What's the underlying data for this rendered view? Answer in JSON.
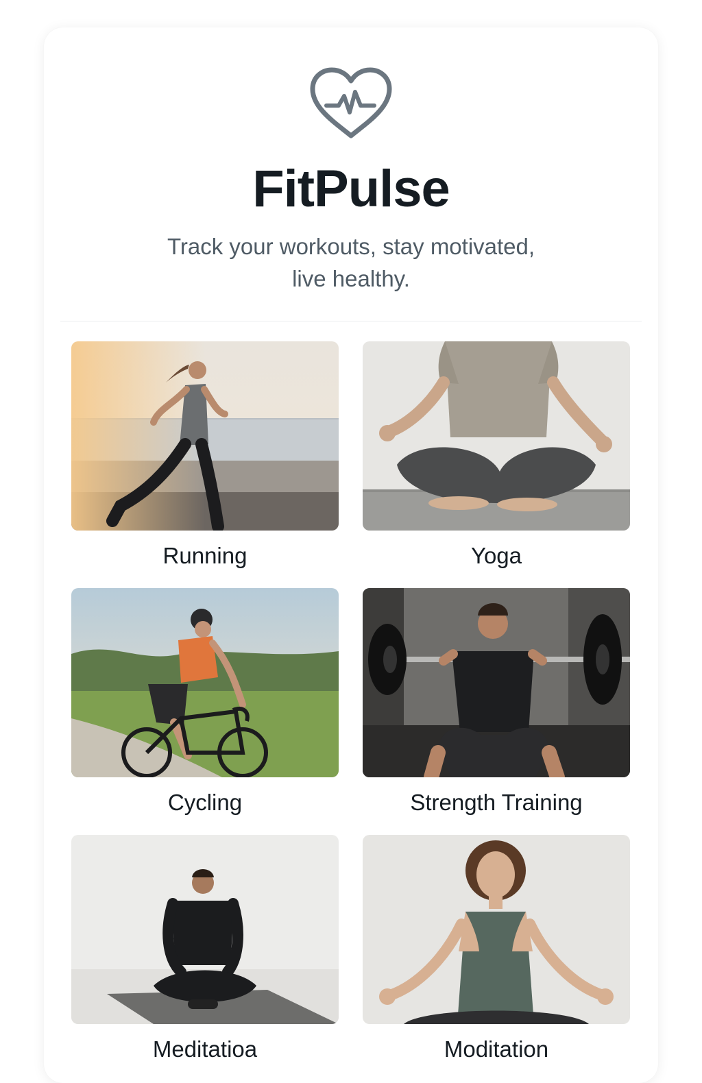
{
  "app": {
    "title": "FitPulse",
    "tagline_line1": "Track your workouts, stay motivated,",
    "tagline_line2": "live healthy.",
    "logo_icon": "heart-pulse-icon",
    "accent_color": "#6b7680"
  },
  "activities": [
    {
      "label": "Running",
      "image": "woman-running-by-water"
    },
    {
      "label": "Yoga",
      "image": "woman-seated-lotus-pose"
    },
    {
      "label": "Cycling",
      "image": "man-road-cycling"
    },
    {
      "label": "Strength Training",
      "image": "man-barbell-squat"
    },
    {
      "label": "Meditatioa",
      "image": "man-seated-meditation"
    },
    {
      "label": "Moditation",
      "image": "woman-seated-meditation"
    }
  ]
}
